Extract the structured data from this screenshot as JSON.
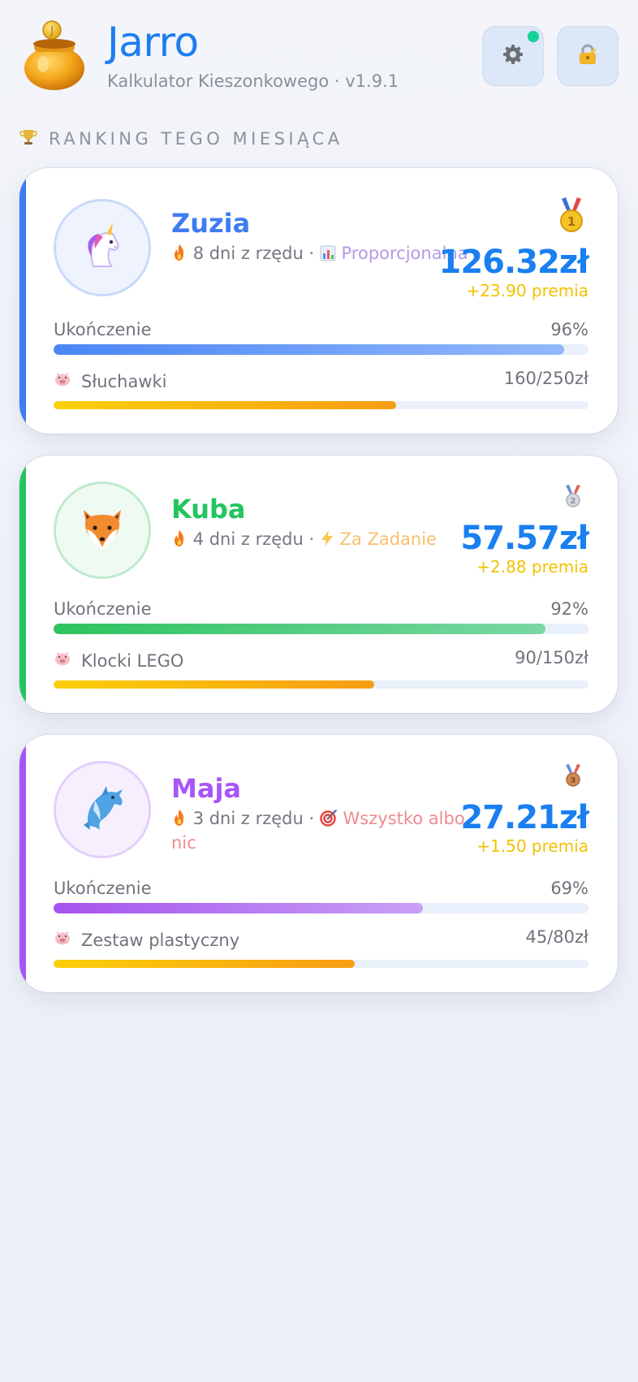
{
  "app": {
    "title": "Jarro",
    "subtitle": "Kalkulator Kieszonkowego · v1.9.1",
    "accent_color": "#1e7cf2"
  },
  "header_buttons": [
    {
      "name": "settings-button",
      "icon": "gear-icon",
      "has_notification": true
    },
    {
      "name": "lock-button",
      "icon": "lock-icon"
    }
  ],
  "section": {
    "icon": "trophy-icon",
    "title": "RANKING TEGO MIESIĄCA"
  },
  "kids": [
    {
      "name": "Zuzia",
      "color": "#3f7cf0",
      "avatar": "unicorn-icon",
      "rank": 1,
      "medal": "gold-medal-icon",
      "streak": "8 dni z rzędu ·",
      "mode_icon": "chart-icon",
      "mode": "Proporcjonalna",
      "mode_color": "#b39ae6",
      "amount": "126.32zł",
      "bonus": "+23.90 premia",
      "completion_label": "Ukończenie",
      "completion_text": "96%",
      "completion": 0.955,
      "goal_name": "Słuchawki",
      "goal_text": "160/250zł",
      "goal_progress": 0.64
    },
    {
      "name": "Kuba",
      "color": "#22c55e",
      "avatar": "fox-icon",
      "rank": 2,
      "medal": "silver-medal-icon",
      "streak": "4 dni z rzędu ·",
      "mode_icon": "lightning-icon",
      "mode": "Za Zadanie",
      "mode_color": "#f7c06e",
      "amount": "57.57zł",
      "bonus": "+2.88 premia",
      "completion_label": "Ukończenie",
      "completion_text": "92%",
      "completion": 0.92,
      "goal_name": "Klocki LEGO",
      "goal_text": "90/150zł",
      "goal_progress": 0.6
    },
    {
      "name": "Maja",
      "color": "#a855f7",
      "avatar": "dolphin-icon",
      "rank": 3,
      "medal": "bronze-medal-icon",
      "streak": "3 dni z rzędu ·",
      "mode_icon": "target-icon",
      "mode": "Wszystko albo nic",
      "mode_color": "#f08a8e",
      "amount": "27.21zł",
      "bonus": "+1.50 premia",
      "completion_label": "Ukończenie",
      "completion_text": "69%",
      "completion": 0.69,
      "goal_name": "Zestaw plastyczny",
      "goal_text": "45/80zł",
      "goal_progress": 0.5625
    }
  ]
}
